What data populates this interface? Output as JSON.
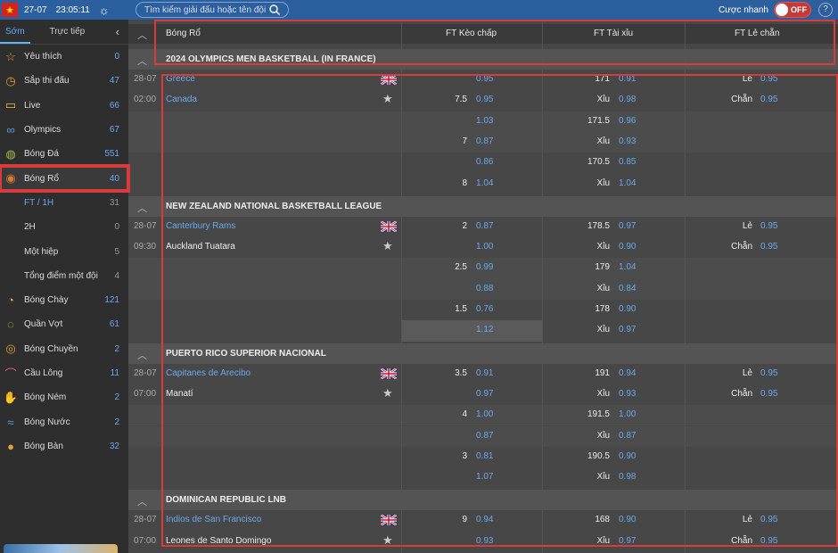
{
  "topbar": {
    "date": "27-07",
    "time": "23:05:11",
    "search_placeholder": "Tìm kiếm giải đấu hoặc tên đội",
    "quick_bet_label": "Cược nhanh",
    "quick_bet_state": "OFF",
    "help": "?"
  },
  "sidebar": {
    "tabs": [
      "Sớm",
      "Trực tiếp"
    ],
    "items": [
      {
        "label": "Yêu thích",
        "count": "0",
        "icon": "star-icon"
      },
      {
        "label": "Sắp thi đấu",
        "count": "47",
        "icon": "upcoming-icon"
      },
      {
        "label": "Live",
        "count": "66",
        "icon": "live-tv-icon"
      },
      {
        "label": "Olympics",
        "count": "67",
        "icon": "olympic-rings-icon"
      },
      {
        "label": "Bóng Đá",
        "count": "551",
        "icon": "soccer-ball-icon"
      },
      {
        "label": "Bóng Rổ",
        "count": "40",
        "icon": "basketball-icon"
      }
    ],
    "subitems": [
      {
        "label": "FT / 1H",
        "count": "31"
      },
      {
        "label": "2H",
        "count": "0"
      },
      {
        "label": "Một hiệp",
        "count": "5"
      },
      {
        "label": "Tổng điểm một đội",
        "count": "4"
      }
    ],
    "items2": [
      {
        "label": "Bóng Chày",
        "count": "121",
        "icon": "baseball-icon"
      },
      {
        "label": "Quần Vợt",
        "count": "61",
        "icon": "tennis-icon"
      },
      {
        "label": "Bóng Chuyền",
        "count": "2",
        "icon": "volleyball-icon"
      },
      {
        "label": "Cầu Lông",
        "count": "11",
        "icon": "badminton-icon"
      },
      {
        "label": "Bóng Ném",
        "count": "2",
        "icon": "handball-icon"
      },
      {
        "label": "Bóng Nước",
        "count": "2",
        "icon": "waterpolo-icon"
      },
      {
        "label": "Bóng Bàn",
        "count": "32",
        "icon": "table-tennis-icon"
      }
    ]
  },
  "header": {
    "sport": "Bóng Rổ",
    "col1": "FT Kèo chấp",
    "col2": "FT Tài xỉu",
    "col3": "FT Lẻ chẵn"
  },
  "labels": {
    "xiu": "Xỉu",
    "le": "Lẻ",
    "chan": "Chẵn"
  },
  "leagues": [
    {
      "name": "2024 OLYMPICS MEN BASKETBALL (IN FRANCE)",
      "date": "28-07",
      "time": "02:00",
      "home": "Greece",
      "away": "Canada",
      "lines": [
        {
          "hc": "",
          "hc_o1": "0.95",
          "hc_o2": "0.95",
          "hc_v": "7.5",
          "ou": "171",
          "ou_o1": "0.91",
          "ou_o2": "0.98",
          "oe1": "0.95",
          "oe2": "0.95"
        },
        {
          "hc": "",
          "hc_o1": "1.03",
          "hc_o2": "0.87",
          "hc_v": "7",
          "ou": "171.5",
          "ou_o1": "0.96",
          "ou_o2": "0.93"
        },
        {
          "hc": "",
          "hc_o1": "0.86",
          "hc_o2": "1.04",
          "hc_v": "8",
          "ou": "170.5",
          "ou_o1": "0.85",
          "ou_o2": "1.04"
        }
      ]
    },
    {
      "name": "NEW ZEALAND NATIONAL BASKETBALL LEAGUE",
      "date": "28-07",
      "time": "09:30",
      "home": "Canterbury Rams",
      "away": "Auckland Tuatara",
      "lines": [
        {
          "hc_v": "2",
          "hc_o1": "0.87",
          "hc_o2": "1.00",
          "ou": "178.5",
          "ou_o1": "0.97",
          "ou_o2": "0.90",
          "oe1": "0.95",
          "oe2": "0.95"
        },
        {
          "hc_v": "2.5",
          "hc_o1": "0.99",
          "hc_o2": "0.88",
          "ou": "179",
          "ou_o1": "1.04",
          "ou_o2": "0.84"
        },
        {
          "hc_v": "1.5",
          "hc_o1": "0.76",
          "hc_o2": "1.12",
          "ou": "178",
          "ou_o1": "0.90",
          "ou_o2": "0.97"
        }
      ]
    },
    {
      "name": "PUERTO RICO SUPERIOR NACIONAL",
      "date": "28-07",
      "time": "07:00",
      "home": "Capitanes de Arecibo",
      "away": "Manatí",
      "lines": [
        {
          "hc_v": "3.5",
          "hc_o1": "0.91",
          "hc_o2": "0.97",
          "ou": "191",
          "ou_o1": "0.94",
          "ou_o2": "0.93",
          "oe1": "0.95",
          "oe2": "0.95"
        },
        {
          "hc_v": "4",
          "hc_o1": "1.00",
          "hc_o2": "0.87",
          "ou": "191.5",
          "ou_o1": "1.00",
          "ou_o2": "0.87"
        },
        {
          "hc_v": "3",
          "hc_o1": "0.81",
          "hc_o2": "1.07",
          "ou": "190.5",
          "ou_o1": "0.90",
          "ou_o2": "0.98"
        }
      ]
    },
    {
      "name": "DOMINICAN REPUBLIC LNB",
      "date": "28-07",
      "time": "07:00",
      "home": "Indios de San Francisco",
      "away": "Leones de Santo Domingo",
      "lines": [
        {
          "hc_v": "9",
          "hc_o1": "0.94",
          "hc_o2": "0.93",
          "ou": "168",
          "ou_o1": "0.90",
          "ou_o2": "0.97",
          "oe1": "0.95",
          "oe2": "0.95"
        }
      ]
    }
  ]
}
